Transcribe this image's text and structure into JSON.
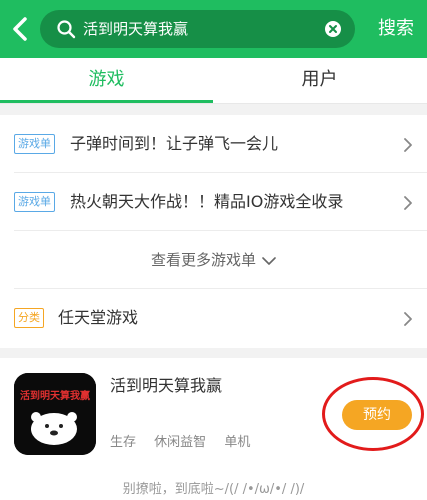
{
  "header": {
    "search_query": "活到明天算我赢",
    "search_button": "搜索"
  },
  "tabs": [
    {
      "label": "游戏",
      "active": true
    },
    {
      "label": "用户",
      "active": false
    }
  ],
  "list": {
    "items": [
      {
        "tag": "游戏单",
        "title": "子弹时间到！让子弹飞一会儿"
      },
      {
        "tag": "游戏单",
        "title": "热火朝天大作战！！精品IO游戏全收录"
      }
    ],
    "more_label": "查看更多游戏单",
    "category": {
      "tag": "分类",
      "title": "任天堂游戏"
    }
  },
  "game": {
    "name": "活到明天算我赢",
    "icon_text": "活到明天算我赢",
    "tags": [
      "生存",
      "休闲益智",
      "单机"
    ],
    "action_label": "预约"
  },
  "footer": "别撩啦，到底啦~/(/ /•/ω/•/ /)/",
  "colors": {
    "brand": "#1fbd60",
    "search_bg": "#168f47",
    "tag_blue": "#5aa9e6",
    "tag_orange": "#f5a623",
    "reserve": "#f5a623",
    "highlight_ring": "#e21b1b"
  }
}
